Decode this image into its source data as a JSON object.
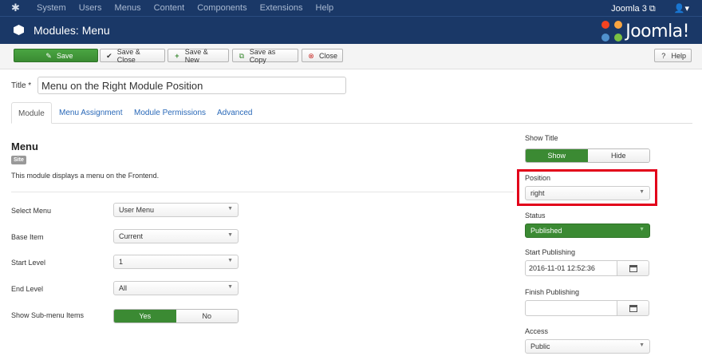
{
  "topnav": {
    "menu": [
      "System",
      "Users",
      "Menus",
      "Content",
      "Components",
      "Extensions",
      "Help"
    ],
    "site_link": "Joomla 3 ⧉",
    "user_icon": "user-icon"
  },
  "header": {
    "title": "Modules: Menu",
    "brand": "Joomla!",
    "icon": "cube-icon"
  },
  "toolbar": {
    "save": "Save",
    "save_close": "Save & Close",
    "save_new": "Save & New",
    "save_copy": "Save as Copy",
    "close": "Close",
    "help": "Help"
  },
  "form": {
    "title_label": "Title *",
    "title_value": "Menu on the Right Module Position",
    "tabs": [
      "Module",
      "Menu Assignment",
      "Module Permissions",
      "Advanced"
    ],
    "module_heading": "Menu",
    "badge": "Site",
    "description": "This module displays a menu on the Frontend.",
    "fields": {
      "select_menu": {
        "label": "Select Menu",
        "value": "User Menu"
      },
      "base_item": {
        "label": "Base Item",
        "value": "Current"
      },
      "start_level": {
        "label": "Start Level",
        "value": "1"
      },
      "end_level": {
        "label": "End Level",
        "value": "All"
      },
      "show_submenu": {
        "label": "Show Sub-menu Items",
        "yes": "Yes",
        "no": "No",
        "selected": "Yes"
      }
    }
  },
  "sidebar": {
    "show_title": {
      "label": "Show Title",
      "show": "Show",
      "hide": "Hide",
      "selected": "Show"
    },
    "position": {
      "label": "Position",
      "value": "right"
    },
    "status": {
      "label": "Status",
      "value": "Published"
    },
    "start_publishing": {
      "label": "Start Publishing",
      "value": "2016-11-01 12:52:36"
    },
    "finish_publishing": {
      "label": "Finish Publishing",
      "value": ""
    },
    "access": {
      "label": "Access",
      "value": "Public"
    }
  },
  "colors": {
    "nav_bg": "#1a3867",
    "save_green": "#3b8a33",
    "highlight_red": "#e2001a",
    "link_blue": "#2a69b8"
  }
}
